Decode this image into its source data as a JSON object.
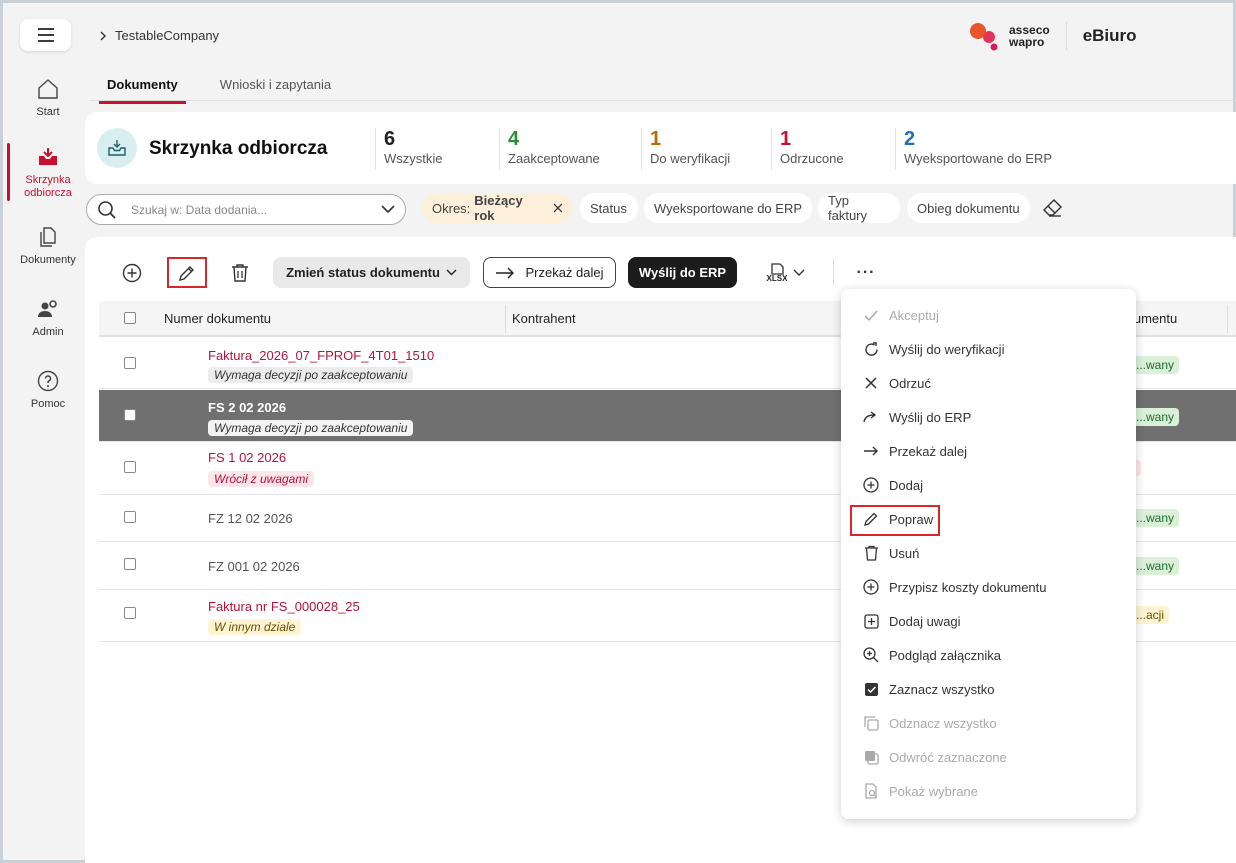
{
  "breadcrumb": {
    "company": "TestableCompany"
  },
  "brand": {
    "logo_line1": "asseco",
    "logo_line2": "wapro",
    "product": "eBiuro"
  },
  "sidebar": {
    "items": [
      {
        "label": "Start",
        "icon": "home-icon"
      },
      {
        "label": "Skrzynka odbiorcza",
        "icon": "inbox-icon",
        "active": true
      },
      {
        "label": "Dokumenty",
        "icon": "documents-icon"
      },
      {
        "label": "Admin",
        "icon": "admin-icon"
      },
      {
        "label": "Pomoc",
        "icon": "help-icon"
      }
    ]
  },
  "tabs": [
    {
      "label": "Dokumenty",
      "active": true
    },
    {
      "label": "Wnioski i zapytania"
    }
  ],
  "summary": {
    "title": "Skrzynka odbiorcza",
    "stats": [
      {
        "num": "6",
        "label": "Wszystkie",
        "color": "#222222"
      },
      {
        "num": "4",
        "label": "Zaakceptowane",
        "color": "#2e8b3a"
      },
      {
        "num": "1",
        "label": "Do weryfikacji",
        "color": "#b76e00"
      },
      {
        "num": "1",
        "label": "Odrzucone",
        "color": "#c8102e"
      },
      {
        "num": "2",
        "label": "Wyeksportowane do ERP",
        "color": "#1f6fb5"
      }
    ]
  },
  "filters": {
    "search_placeholder": "Szukaj w: Data dodania...",
    "period_prefix": "Okres:",
    "period_value": "Bieżący rok",
    "chips": [
      "Status",
      "Wyeksportowane do ERP",
      "Typ faktury",
      "Obieg dokumentu"
    ]
  },
  "toolbar": {
    "status_label": "Zmień status dokumentu",
    "forward_label": "Przekaż dalej",
    "erp_label": "Wyślij do ERP",
    "xlsx_label": "XLSX",
    "more_label": "···"
  },
  "table": {
    "headers": [
      "Numer dokumentu",
      "Kontrahent",
      "...umentu"
    ],
    "rows": [
      {
        "number": "Faktura_2026_07_FPROF_4T01_1510",
        "tag": "Wymaga decyzji po zaakceptowaniu",
        "status": "...wany"
      },
      {
        "number": "FS 2 02 2026",
        "tag": "Wymaga decyzji po zaakceptowaniu",
        "status": "...wany"
      },
      {
        "number": "FS 1 02 2026",
        "tag": "Wrócił z uwagami",
        "status": ""
      },
      {
        "number": "FZ 12 02 2026",
        "tag": "",
        "status": "...wany"
      },
      {
        "number": "FZ 001 02 2026",
        "tag": "",
        "status": "...wany"
      },
      {
        "number": "Faktura nr FS_000028_25",
        "tag": "W innym dziale",
        "status": "...acji"
      }
    ]
  },
  "menu": {
    "items": [
      {
        "label": "Akceptuj",
        "icon": "check-icon",
        "disabled": true
      },
      {
        "label": "Wyślij do weryfikacji",
        "icon": "refresh-icon"
      },
      {
        "label": "Odrzuć",
        "icon": "close-icon"
      },
      {
        "label": "Wyślij do ERP",
        "icon": "share-arrow-icon"
      },
      {
        "label": "Przekaż dalej",
        "icon": "arrow-right-icon"
      },
      {
        "label": "Dodaj",
        "icon": "plus-circle-icon"
      },
      {
        "label": "Popraw",
        "icon": "pencil-icon"
      },
      {
        "label": "Usuń",
        "icon": "trash-icon"
      },
      {
        "label": "Przypisz koszty dokumentu",
        "icon": "plus-circle-icon"
      },
      {
        "label": "Dodaj uwagi",
        "icon": "plus-square-icon"
      },
      {
        "label": "Podgląd załącznika",
        "icon": "zoom-icon"
      },
      {
        "label": "Zaznacz wszystko",
        "icon": "checkbox-checked-icon"
      },
      {
        "label": "Odznacz wszystko",
        "icon": "copy-icon",
        "disabled": true
      },
      {
        "label": "Odwróć zaznaczone",
        "icon": "invert-icon",
        "disabled": true
      },
      {
        "label": "Pokaż wybrane",
        "icon": "doc-search-icon",
        "disabled": true
      }
    ]
  }
}
